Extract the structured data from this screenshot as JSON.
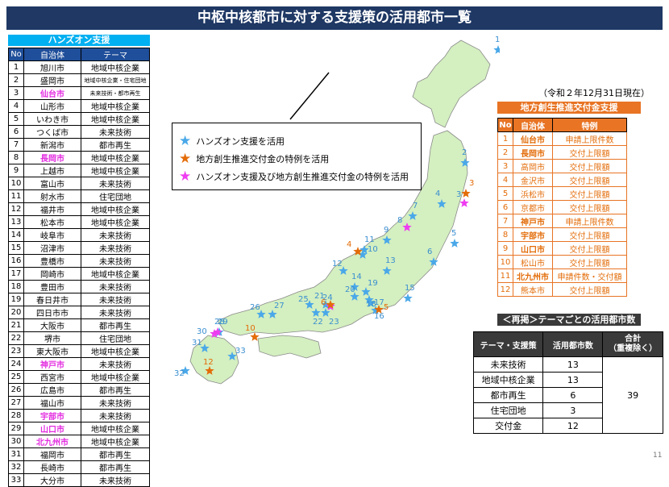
{
  "title": "中枢中核都市に対する支援策の活用都市一覧",
  "date_note": "（令和２年12月31日現在）",
  "page_number": "11",
  "colors": {
    "blue_star": "#4aa8e8",
    "orange_star": "#e36c09",
    "pink_star": "#ee3df0",
    "map_fill": "#d4efc0"
  },
  "legend": {
    "items": [
      {
        "icon": "blue-star-icon",
        "label": "ハンズオン支援を活用"
      },
      {
        "icon": "orange-star-icon",
        "label": "地方創生推進交付金の特例を活用"
      },
      {
        "icon": "pink-star-icon",
        "label": "ハンズオン支援及び地方創生推進交付金の特例を活用"
      }
    ]
  },
  "handson": {
    "title": "ハンズオン支援",
    "headers": [
      "No",
      "自治体",
      "テーマ"
    ],
    "rows": [
      {
        "no": "1",
        "city": "旭川市",
        "theme": "地域中核企業"
      },
      {
        "no": "2",
        "city": "盛岡市",
        "theme": "地域中核企業・住宅団地",
        "small": true
      },
      {
        "no": "3",
        "city": "仙台市",
        "theme": "未来技術・都市再生",
        "small": true,
        "pink": true
      },
      {
        "no": "4",
        "city": "山形市",
        "theme": "地域中核企業"
      },
      {
        "no": "5",
        "city": "いわき市",
        "theme": "地域中核企業"
      },
      {
        "no": "6",
        "city": "つくば市",
        "theme": "未来技術"
      },
      {
        "no": "7",
        "city": "新潟市",
        "theme": "都市再生"
      },
      {
        "no": "8",
        "city": "長岡市",
        "theme": "地域中核企業",
        "pink": true
      },
      {
        "no": "9",
        "city": "上越市",
        "theme": "地域中核企業"
      },
      {
        "no": "10",
        "city": "富山市",
        "theme": "未来技術"
      },
      {
        "no": "11",
        "city": "射水市",
        "theme": "住宅団地"
      },
      {
        "no": "12",
        "city": "福井市",
        "theme": "地域中核企業"
      },
      {
        "no": "13",
        "city": "松本市",
        "theme": "地域中核企業"
      },
      {
        "no": "14",
        "city": "岐阜市",
        "theme": "未来技術"
      },
      {
        "no": "15",
        "city": "沼津市",
        "theme": "未来技術"
      },
      {
        "no": "16",
        "city": "豊橋市",
        "theme": "未来技術"
      },
      {
        "no": "17",
        "city": "岡崎市",
        "theme": "地域中核企業"
      },
      {
        "no": "18",
        "city": "豊田市",
        "theme": "未来技術"
      },
      {
        "no": "19",
        "city": "春日井市",
        "theme": "未来技術"
      },
      {
        "no": "20",
        "city": "四日市市",
        "theme": "未来技術"
      },
      {
        "no": "21",
        "city": "大阪市",
        "theme": "都市再生"
      },
      {
        "no": "22",
        "city": "堺市",
        "theme": "住宅団地"
      },
      {
        "no": "23",
        "city": "東大阪市",
        "theme": "地域中核企業"
      },
      {
        "no": "24",
        "city": "神戸市",
        "theme": "未来技術",
        "pink": true
      },
      {
        "no": "25",
        "city": "西宮市",
        "theme": "地域中核企業"
      },
      {
        "no": "26",
        "city": "広島市",
        "theme": "都市再生"
      },
      {
        "no": "27",
        "city": "福山市",
        "theme": "未来技術"
      },
      {
        "no": "28",
        "city": "宇部市",
        "theme": "未来技術",
        "pink": true
      },
      {
        "no": "29",
        "city": "山口市",
        "theme": "地域中核企業",
        "pink": true
      },
      {
        "no": "30",
        "city": "北九州市",
        "theme": "地域中核企業",
        "pink": true
      },
      {
        "no": "31",
        "city": "福岡市",
        "theme": "都市再生"
      },
      {
        "no": "32",
        "city": "長崎市",
        "theme": "都市再生"
      },
      {
        "no": "33",
        "city": "大分市",
        "theme": "未来技術"
      }
    ]
  },
  "chihou": {
    "title": "地方創生推進交付金支援",
    "headers": [
      "No",
      "自治体",
      "特例"
    ],
    "rows": [
      {
        "no": "1",
        "city": "仙台市",
        "special": "申請上限件数",
        "pink": true
      },
      {
        "no": "2",
        "city": "長岡市",
        "special": "交付上限額",
        "pink": true
      },
      {
        "no": "3",
        "city": "高岡市",
        "special": "交付上限額"
      },
      {
        "no": "4",
        "city": "金沢市",
        "special": "交付上限額"
      },
      {
        "no": "5",
        "city": "浜松市",
        "special": "交付上限額"
      },
      {
        "no": "6",
        "city": "京都市",
        "special": "交付上限額"
      },
      {
        "no": "7",
        "city": "神戸市",
        "special": "申請上限件数",
        "pink": true
      },
      {
        "no": "8",
        "city": "宇部市",
        "special": "交付上限額",
        "pink": true
      },
      {
        "no": "9",
        "city": "山口市",
        "special": "交付上限額",
        "pink": true
      },
      {
        "no": "10",
        "city": "松山市",
        "special": "交付上限額"
      },
      {
        "no": "11",
        "city": "北九州市",
        "special": "申請件数・交付額",
        "pink": true
      },
      {
        "no": "12",
        "city": "熊本市",
        "special": "交付上限額"
      }
    ]
  },
  "summary": {
    "title": "＜再掲＞テーマごとの活用都市数",
    "headers": [
      "テーマ・支援策",
      "活用都市数",
      "合計\n（重複除く）"
    ],
    "rows": [
      {
        "theme": "未来技術",
        "count": "13"
      },
      {
        "theme": "地域中核企業",
        "count": "13"
      },
      {
        "theme": "都市再生",
        "count": "6"
      },
      {
        "theme": "住宅団地",
        "count": "3"
      },
      {
        "theme": "交付金",
        "count": "12"
      }
    ],
    "total": "39"
  },
  "map": {
    "stars": [
      {
        "label": "1",
        "type": "blue"
      },
      {
        "label": "2",
        "type": "blue"
      },
      {
        "label": "3",
        "type": "pink"
      },
      {
        "label": "4",
        "type": "blue"
      },
      {
        "label": "5",
        "type": "blue"
      },
      {
        "label": "6",
        "type": "blue"
      },
      {
        "label": "7",
        "type": "blue"
      },
      {
        "label": "8",
        "type": "pink"
      },
      {
        "label": "9",
        "type": "blue"
      },
      {
        "label": "10",
        "type": "blue"
      },
      {
        "label": "11",
        "type": "blue"
      },
      {
        "label": "12",
        "type": "blue"
      },
      {
        "label": "13",
        "type": "blue"
      },
      {
        "label": "14",
        "type": "blue"
      },
      {
        "label": "15",
        "type": "blue"
      },
      {
        "label": "16",
        "type": "blue"
      },
      {
        "label": "17",
        "type": "blue"
      },
      {
        "label": "18",
        "type": "blue"
      },
      {
        "label": "19",
        "type": "blue"
      },
      {
        "label": "20",
        "type": "blue"
      },
      {
        "label": "21",
        "type": "blue"
      },
      {
        "label": "22",
        "type": "blue"
      },
      {
        "label": "23",
        "type": "blue"
      },
      {
        "label": "24",
        "type": "pink"
      },
      {
        "label": "25",
        "type": "blue"
      },
      {
        "label": "26",
        "type": "blue"
      },
      {
        "label": "27",
        "type": "blue"
      },
      {
        "label": "28",
        "type": "blue"
      },
      {
        "label": "29",
        "type": "pink"
      },
      {
        "label": "30",
        "type": "pink"
      },
      {
        "label": "31",
        "type": "blue"
      },
      {
        "label": "32",
        "type": "blue"
      },
      {
        "label": "33",
        "type": "blue"
      },
      {
        "label": "3",
        "type": "orange"
      },
      {
        "label": "4",
        "type": "orange"
      },
      {
        "label": "5",
        "type": "orange"
      },
      {
        "label": "6",
        "type": "orange"
      },
      {
        "label": "10",
        "type": "orange"
      },
      {
        "label": "12",
        "type": "orange"
      }
    ]
  }
}
